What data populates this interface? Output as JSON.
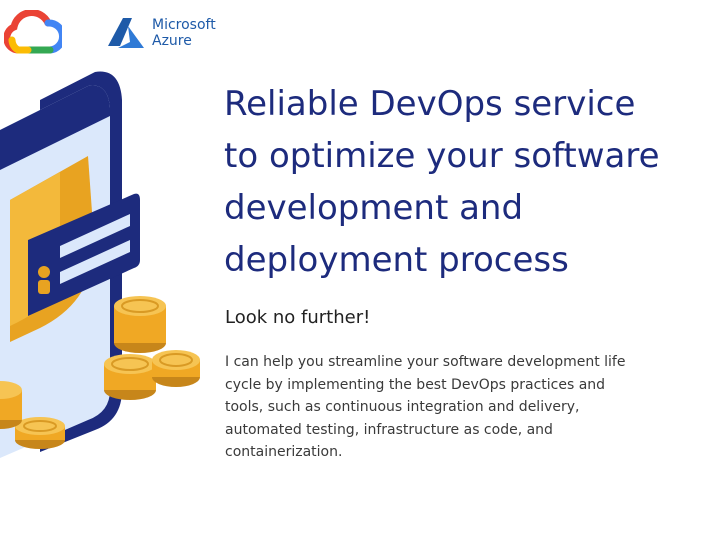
{
  "logos": {
    "google_cloud": {
      "icon": "google-cloud-logo-icon"
    },
    "azure": {
      "icon": "azure-logo-icon",
      "line1": "Microsoft",
      "line2": "Azure"
    }
  },
  "headline": {
    "line1": "Reliable DevOps service",
    "line2": "to optimize your software",
    "line3": "development and",
    "line4": "deployment process"
  },
  "subheadline": "Look no further!",
  "body": "I can help you streamline your software development life cycle by implementing the best DevOps practices and tools, such as continuous integration and delivery, automated testing, infrastructure as code, and containerization.",
  "illustration": {
    "icon": "phone-shield-coins-illustration",
    "colors": {
      "navy": "#1d2b7d",
      "phone_screen": "#dbe8fb",
      "shield": "#e8a321",
      "coin": "#f0a824"
    }
  },
  "colors": {
    "headline": "#1d2b7d",
    "azure_brand": "#1e5aa8"
  }
}
